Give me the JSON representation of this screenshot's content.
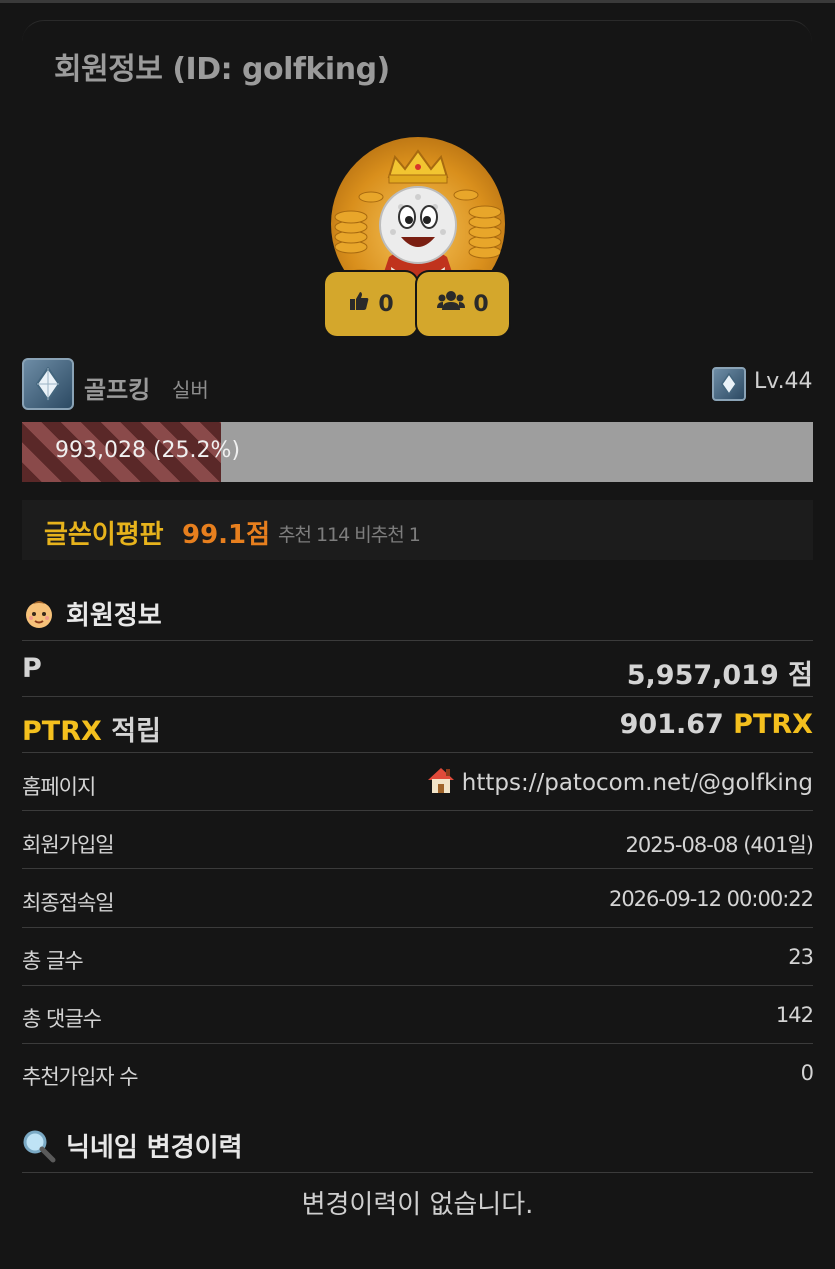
{
  "header": {
    "title": "회원정보 (ID: golfking)"
  },
  "profile": {
    "likes": "0",
    "followers": "0",
    "username": "골프킹",
    "rank": "실버",
    "level": "Lv.44",
    "exp_text": "993,028 (25.2%)",
    "exp_progress": 0.252
  },
  "reputation": {
    "label": "글쓴이평판",
    "score": "99.1점",
    "detail": "추천 114 비추천 1"
  },
  "member_info": {
    "heading": "회원정보",
    "rows": [
      {
        "label": "P",
        "value": "5,957,019 점"
      },
      {
        "label_a": "PTRX",
        "label_b": " 적립",
        "value_a": "901.67 ",
        "value_b": "PTRX"
      },
      {
        "label": "홈페이지",
        "value": "https://patocom.net/@golfking"
      },
      {
        "label": "회원가입일",
        "value": "2025-08-08 (401일)"
      },
      {
        "label": "최종접속일",
        "value": "2026-09-12 00:00:22"
      },
      {
        "label": "총 글수",
        "value": "23"
      },
      {
        "label": "총 댓글수",
        "value": "142"
      },
      {
        "label": "추천가입자 수",
        "value": "0"
      }
    ]
  },
  "nickname_history": {
    "heading": "닉네임 변경이력",
    "empty_text": "변경이력이 없습니다."
  },
  "colors": {
    "accent_gold": "#f4c01e",
    "reputation_orange": "#e77f1e",
    "pill_gold": "#d4a72c"
  },
  "icons": [
    "thumbs-up-icon",
    "users-icon",
    "rank-diamond-icon",
    "baby-face-icon",
    "house-icon",
    "magnifier-icon"
  ]
}
